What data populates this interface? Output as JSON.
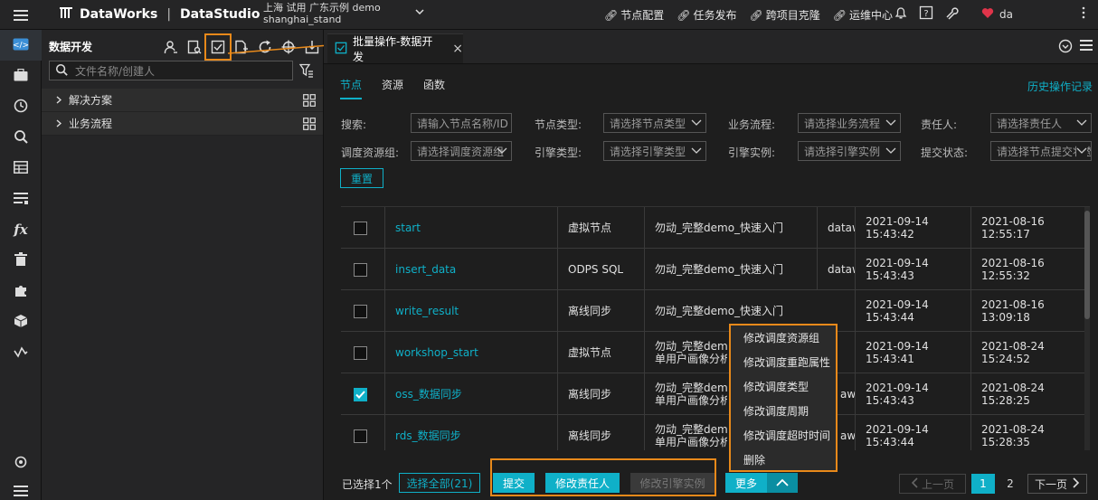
{
  "app": {
    "brand": "DataWorks",
    "product": "DataStudio",
    "region_top": "上海 试用 广东示例 demo",
    "region": "shanghai_stand"
  },
  "topnav": [
    {
      "label": "节点配置"
    },
    {
      "label": "任务发布"
    },
    {
      "label": "跨项目克隆"
    },
    {
      "label": "运维中心"
    }
  ],
  "user": {
    "name": "da"
  },
  "explorer": {
    "title": "数据开发",
    "search_placeholder": "文件名称/创建人",
    "tree": [
      {
        "label": "解决方案"
      },
      {
        "label": "业务流程"
      }
    ]
  },
  "editor": {
    "tab_title": "批量操作-数据开发",
    "subtabs": [
      "节点",
      "资源",
      "函数"
    ],
    "history_link": "历史操作记录",
    "filters": {
      "search_label": "搜索:",
      "search_placeholder": "请输入节点名称/ID",
      "node_type_label": "节点类型:",
      "node_type_placeholder": "请选择节点类型",
      "flow_label": "业务流程:",
      "flow_placeholder": "请选择业务流程",
      "owner_label": "责任人:",
      "owner_placeholder": "请选择责任人",
      "resgroup_label": "调度资源组:",
      "resgroup_placeholder": "请选择调度资源组",
      "engine_type_label": "引擎类型:",
      "engine_type_placeholder": "请选择引擎类型",
      "engine_inst_label": "引擎实例:",
      "engine_inst_placeholder": "请选择引擎实例",
      "submit_label": "提交状态:",
      "submit_placeholder": "请选择节点提交状态",
      "reset": "重置"
    },
    "rows": [
      {
        "name": "start",
        "type": "虚拟节点",
        "flow": "勿动_完整demo_快速入门",
        "flow2": "",
        "engine": "dataw",
        "modified": "2021-09-14",
        "modified_time": "15:43:42",
        "created": "2021-08-16",
        "created_time": "12:55:17",
        "checked": false
      },
      {
        "name": "insert_data",
        "type": "ODPS SQL",
        "flow": "勿动_完整demo_快速入门",
        "flow2": "",
        "engine": "dataw",
        "modified": "2021-09-14",
        "modified_time": "15:43:43",
        "created": "2021-08-16",
        "created_time": "12:55:32",
        "checked": false
      },
      {
        "name": "write_result",
        "type": "离线同步",
        "flow": "勿动_完整demo_快速入门",
        "flow2": "",
        "engine": "",
        "modified": "2021-09-14",
        "modified_time": "15:43:44",
        "created": "2021-08-16",
        "created_time": "13:09:18",
        "checked": false
      },
      {
        "name": "workshop_start",
        "type": "虚拟节点",
        "flow": "勿动_完整demo",
        "flow2": "单用户画像分析",
        "engine": "",
        "modified": "2021-09-14",
        "modified_time": "15:43:41",
        "created": "2021-08-24",
        "created_time": "15:24:52",
        "checked": false
      },
      {
        "name": "oss_数据同步",
        "type": "离线同步",
        "flow": "勿动_完整demo",
        "flow2": "单用户画像分析",
        "engine": "aw",
        "modified": "2021-09-14",
        "modified_time": "15:43:43",
        "created": "2021-08-24",
        "created_time": "15:28:25",
        "checked": true
      },
      {
        "name": "rds_数据同步",
        "type": "离线同步",
        "flow": "勿动_完整demo",
        "flow2": "单用户画像分析",
        "engine": "aw",
        "modified": "2021-09-14",
        "modified_time": "15:43:44",
        "created": "2021-08-24",
        "created_time": "15:28:35",
        "checked": false
      }
    ],
    "more_menu": [
      "修改调度资源组",
      "修改调度重跑属性",
      "修改调度类型",
      "修改调度周期",
      "修改调度超时时间",
      "删除"
    ],
    "footer": {
      "selected": "已选择1个",
      "select_all": "选择全部(21)",
      "submit": "提交",
      "change_owner": "修改责任人",
      "change_engine": "修改引擎实例",
      "more": "更多",
      "prev": "上一页",
      "page1": "1",
      "page2": "2",
      "next": "下一页"
    }
  },
  "colors": {
    "accent": "#0fb0c8",
    "highlight": "#e8891a"
  }
}
